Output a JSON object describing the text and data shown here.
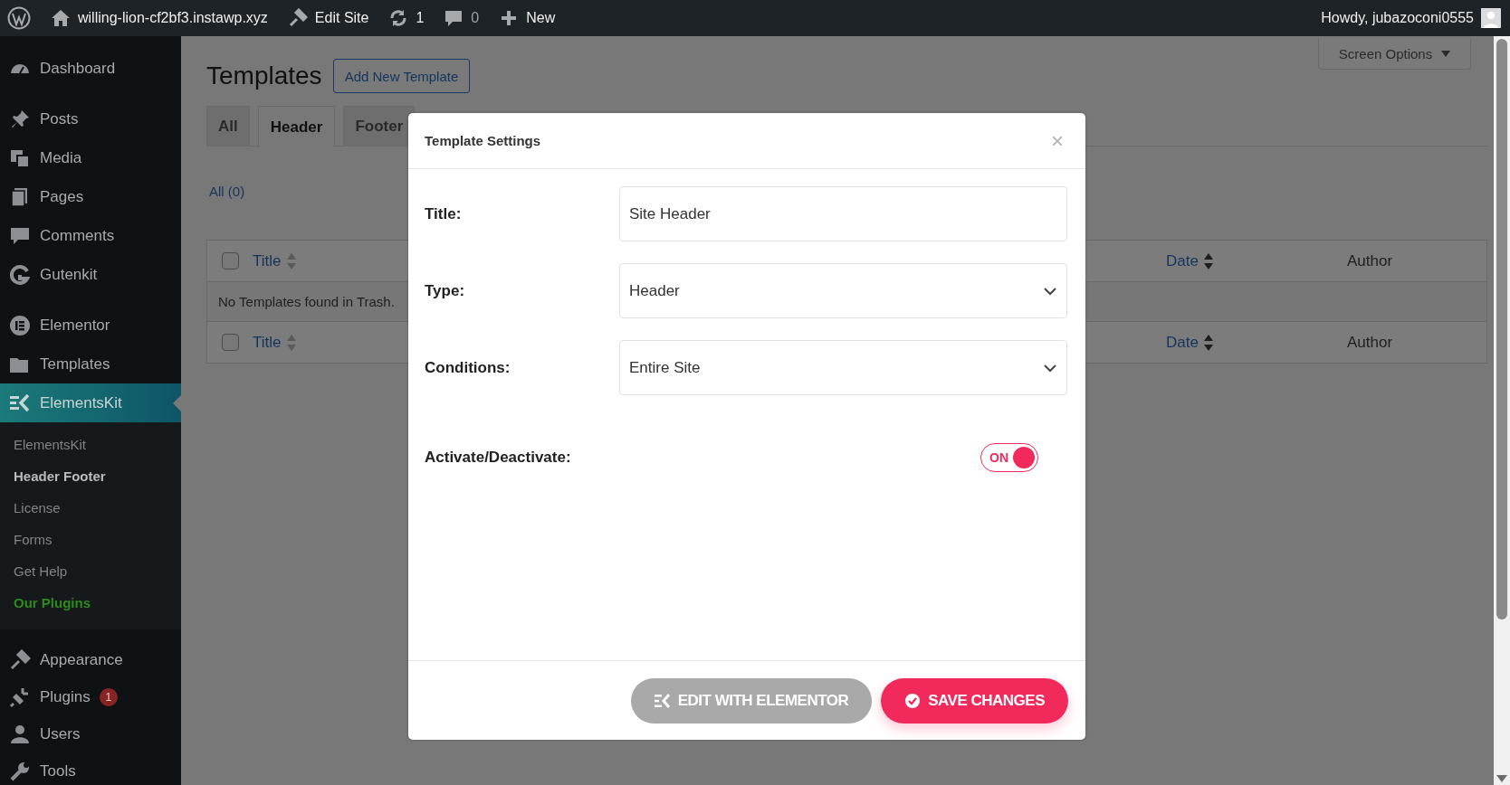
{
  "admin_bar": {
    "site": "willing-lion-cf2bf3.instawp.xyz",
    "edit_site": "Edit Site",
    "updates": "1",
    "comments": "0",
    "new": "New",
    "greeting": "Howdy, jubazoconi0555"
  },
  "sidebar": {
    "groups": [
      [
        {
          "label": "Dashboard",
          "selected": false
        }
      ],
      [
        {
          "label": "Posts",
          "selected": false
        },
        {
          "label": "Media",
          "selected": false
        },
        {
          "label": "Pages",
          "selected": false
        },
        {
          "label": "Comments",
          "selected": false
        },
        {
          "label": "Gutenkit",
          "selected": false
        }
      ],
      [
        {
          "label": "Elementor",
          "selected": false
        },
        {
          "label": "Templates",
          "selected": false
        },
        {
          "label": "ElementsKit",
          "selected": true,
          "children": [
            {
              "label": "ElementsKit",
              "selected": false,
              "kind": "link"
            },
            {
              "label": "Header Footer",
              "selected": true,
              "kind": "link"
            },
            {
              "label": "License",
              "selected": false,
              "kind": "link"
            },
            {
              "label": "Forms",
              "selected": false,
              "kind": "link"
            },
            {
              "label": "Get Help",
              "selected": false,
              "kind": "link"
            },
            {
              "label": "Our Plugins",
              "selected": false,
              "kind": "promo"
            }
          ]
        }
      ],
      [
        {
          "label": "Appearance",
          "selected": false
        },
        {
          "label": "Plugins",
          "selected": false,
          "badge": "1"
        },
        {
          "label": "Users",
          "selected": false
        },
        {
          "label": "Tools",
          "selected": false
        }
      ]
    ]
  },
  "page": {
    "screen_options": "Screen Options",
    "title": "Templates",
    "add_button": "Add New Template",
    "tabs": [
      {
        "label": "All",
        "selected": false
      },
      {
        "label": "Header",
        "selected": true
      },
      {
        "label": "Footer",
        "selected": false
      }
    ],
    "views": "All (0)",
    "table": {
      "header": {
        "checked": false,
        "columns": [
          {
            "label": "Title",
            "kind": "sortable"
          },
          {
            "label": "Date",
            "kind": "sortable"
          },
          {
            "label": "Author",
            "kind": "plain"
          }
        ]
      },
      "empty_message": "No Templates found in Trash.",
      "footer": {
        "checked": false,
        "columns": [
          {
            "label": "Title",
            "kind": "sortable"
          },
          {
            "label": "Date",
            "kind": "sortable"
          },
          {
            "label": "Author",
            "kind": "plain"
          }
        ]
      }
    }
  },
  "modal": {
    "title": "Template Settings",
    "close": "×",
    "fields": [
      {
        "label": "Title:",
        "kind": "text",
        "value": "Site Header"
      },
      {
        "label": "Type:",
        "kind": "select",
        "value": "Header"
      },
      {
        "label": "Conditions:",
        "kind": "select",
        "value": "Entire Site"
      },
      {
        "label": "Activate/Deactivate:",
        "kind": "toggle",
        "on": true,
        "text": "ON"
      }
    ],
    "buttons": [
      {
        "label": "EDIT WITH ELEMENTOR",
        "kind": "elementor",
        "disabled": true
      },
      {
        "label": "SAVE CHANGES",
        "kind": "save",
        "disabled": false
      }
    ]
  }
}
